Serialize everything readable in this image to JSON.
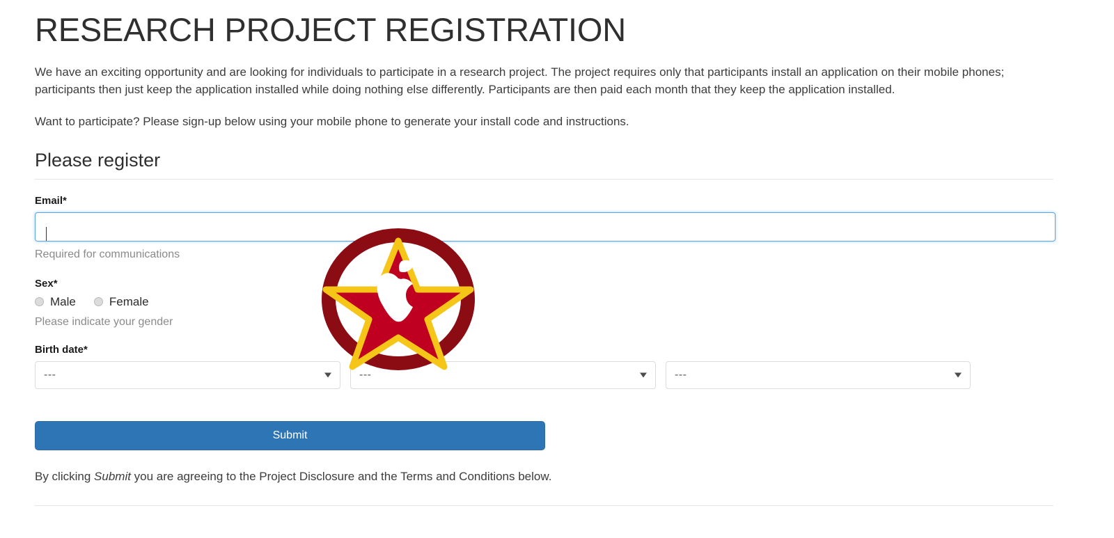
{
  "page": {
    "title": "RESEARCH PROJECT REGISTRATION",
    "intro_paragraph": "We have an exciting opportunity and are looking for individuals to participate in a research project. The project requires only that participants install an application on their mobile phones; participants then just keep the application installed while doing nothing else differently. Participants are then paid each month that they keep the application installed.",
    "signup_prompt": "Want to participate? Please sign-up below using your mobile phone to generate your install code and instructions.",
    "section_heading": "Please register"
  },
  "form": {
    "email": {
      "label": "Email*",
      "value": "",
      "placeholder": "",
      "help": "Required for communications"
    },
    "sex": {
      "label": "Sex*",
      "options": [
        {
          "label": "Male",
          "checked": false
        },
        {
          "label": "Female",
          "checked": false
        }
      ],
      "help": "Please indicate your gender"
    },
    "birth_date": {
      "label": "Birth date*",
      "selects": [
        {
          "value": "---"
        },
        {
          "value": "---"
        },
        {
          "value": "---"
        }
      ]
    },
    "submit_label": "Submit",
    "agreement": {
      "prefix": "By clicking ",
      "emphasis": "Submit",
      "suffix": " you are agreeing to the Project Disclosure and the Terms and Conditions below."
    }
  },
  "logo": {
    "name": "star-apple-logo",
    "ring_color": "#8B0D13",
    "star_fill": "#C00020",
    "star_outline": "#F5C518",
    "apple_color": "#FFFFFF"
  },
  "colors": {
    "accent_button": "#2E75B6",
    "focus_border": "#5AA5E8",
    "help_text": "#8A8A8A",
    "rule": "#E4E4E4"
  }
}
